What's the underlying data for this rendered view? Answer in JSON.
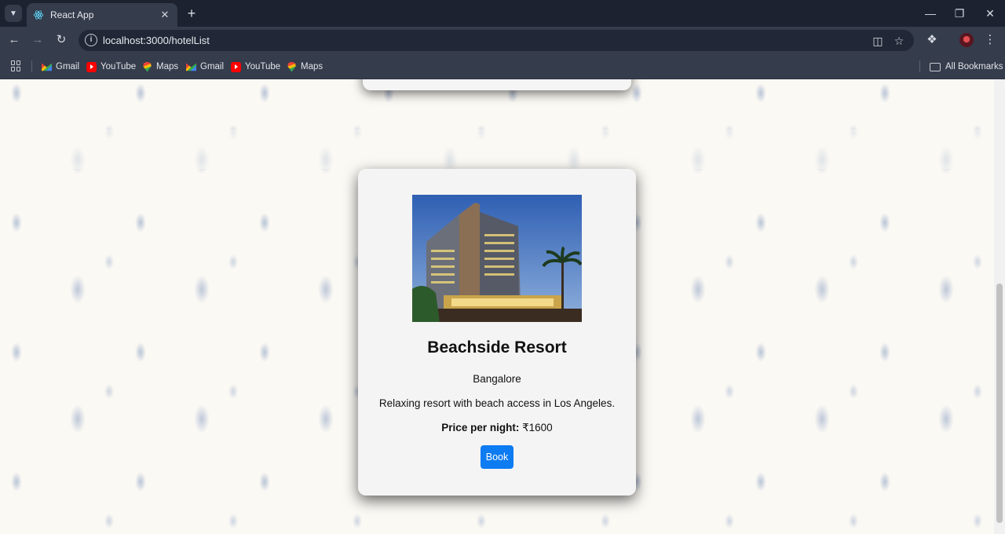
{
  "browser": {
    "tab_title": "React App",
    "url": "localhost:3000/hotelList",
    "bookmarks": [
      {
        "label": "Gmail",
        "icon": "gmail-icon"
      },
      {
        "label": "YouTube",
        "icon": "youtube-icon"
      },
      {
        "label": "Maps",
        "icon": "maps-icon"
      },
      {
        "label": "Gmail",
        "icon": "gmail-icon"
      },
      {
        "label": "YouTube",
        "icon": "youtube-icon"
      },
      {
        "label": "Maps",
        "icon": "maps-icon"
      }
    ],
    "all_bookmarks_label": "All Bookmarks"
  },
  "hotel": {
    "name": "Beachside Resort",
    "city": "Bangalore",
    "description": "Relaxing resort with beach access in Los Angeles.",
    "price_label": "Price per night:",
    "price_value": " ₹1600",
    "book_label": "Book"
  },
  "colors": {
    "book_button": "#0d7bf2",
    "card_background": "#f4f4f4",
    "page_background": "#fbf9f4"
  }
}
